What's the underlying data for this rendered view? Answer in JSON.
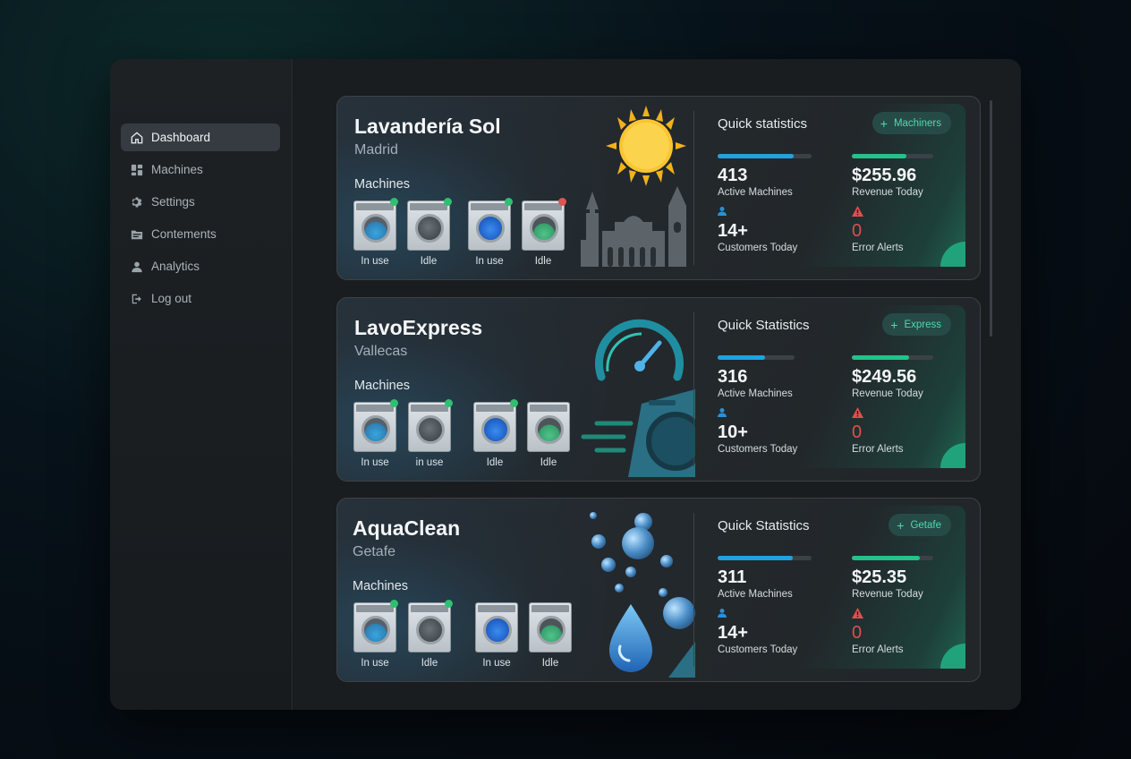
{
  "sidebar": {
    "items": [
      {
        "label": "Dashboard",
        "icon": "home-icon",
        "active": true
      },
      {
        "label": "Machines",
        "icon": "grid-icon",
        "active": false
      },
      {
        "label": "Settings",
        "icon": "gear-icon",
        "active": false
      },
      {
        "label": "Contements",
        "icon": "folder-icon",
        "active": false
      },
      {
        "label": "Analytics",
        "icon": "user-icon",
        "active": false
      },
      {
        "label": "Log out",
        "icon": "logout-icon",
        "active": false
      }
    ]
  },
  "colors": {
    "accent": "#4fd8af",
    "progress_blue": "#1fa3e0",
    "progress_green": "#22c38a",
    "error": "#e04e4e",
    "status_ok": "#2fbf71",
    "status_error": "#e05454"
  },
  "cards": [
    {
      "name": "Lavandería Sol",
      "city": "Madrid",
      "machines_label": "Machines",
      "illustration": "sun-and-city-skyline",
      "machines": [
        {
          "status": "In use",
          "water": "blue",
          "indicator": "ok"
        },
        {
          "status": "Idle",
          "water": "none",
          "indicator": "ok"
        },
        {
          "status": "In use",
          "water": "deepblue",
          "indicator": "ok"
        },
        {
          "status": "Idle",
          "water": "green",
          "indicator": "error"
        }
      ],
      "stats": {
        "title": "Quick statistics",
        "action": "Machiners",
        "active_machines": {
          "value": "413",
          "label": "Active Machines",
          "progress": 0.81
        },
        "revenue": {
          "value": "$255.96",
          "label": "Revenue Today",
          "progress": 0.67
        },
        "customers": {
          "value": "14+",
          "label": "Customers Today"
        },
        "errors": {
          "value": "0",
          "label": "Error Alerts"
        }
      }
    },
    {
      "name": "LavoExpress",
      "city": "Vallecas",
      "machines_label": "Machines",
      "illustration": "speedometer-washer",
      "machines": [
        {
          "status": "In use",
          "water": "blue",
          "indicator": "ok"
        },
        {
          "status": "in use",
          "water": "none",
          "indicator": "ok"
        },
        {
          "status": "Idle",
          "water": "deepblue",
          "indicator": "ok"
        },
        {
          "status": "Idle",
          "water": "green",
          "indicator": "none"
        }
      ],
      "stats": {
        "title": "Quick Statistics",
        "action": "Express",
        "active_machines": {
          "value": "316",
          "label": "Active Machines",
          "progress": 0.62
        },
        "revenue": {
          "value": "$249.56",
          "label": "Revenue Today",
          "progress": 0.7
        },
        "customers": {
          "value": "10+",
          "label": "Customers Today"
        },
        "errors": {
          "value": "0",
          "label": "Error Alerts"
        }
      }
    },
    {
      "name": "AquaClean",
      "city": "Getafe",
      "machines_label": "Machines",
      "illustration": "bubbles-and-drop",
      "machines": [
        {
          "status": "In use",
          "water": "blue",
          "indicator": "ok"
        },
        {
          "status": "Idle",
          "water": "none",
          "indicator": "ok"
        },
        {
          "status": "In use",
          "water": "deepblue",
          "indicator": "none"
        },
        {
          "status": "Idle",
          "water": "green",
          "indicator": "none"
        }
      ],
      "stats": {
        "title": "Quick Statistics",
        "action": "Getafe",
        "active_machines": {
          "value": "311",
          "label": "Active Machines",
          "progress": 0.8
        },
        "revenue": {
          "value": "$25.35",
          "label": "Revenue Today",
          "progress": 0.84
        },
        "customers": {
          "value": "14+",
          "label": "Customers Today"
        },
        "errors": {
          "value": "0",
          "label": "Error Alerts"
        }
      }
    }
  ]
}
